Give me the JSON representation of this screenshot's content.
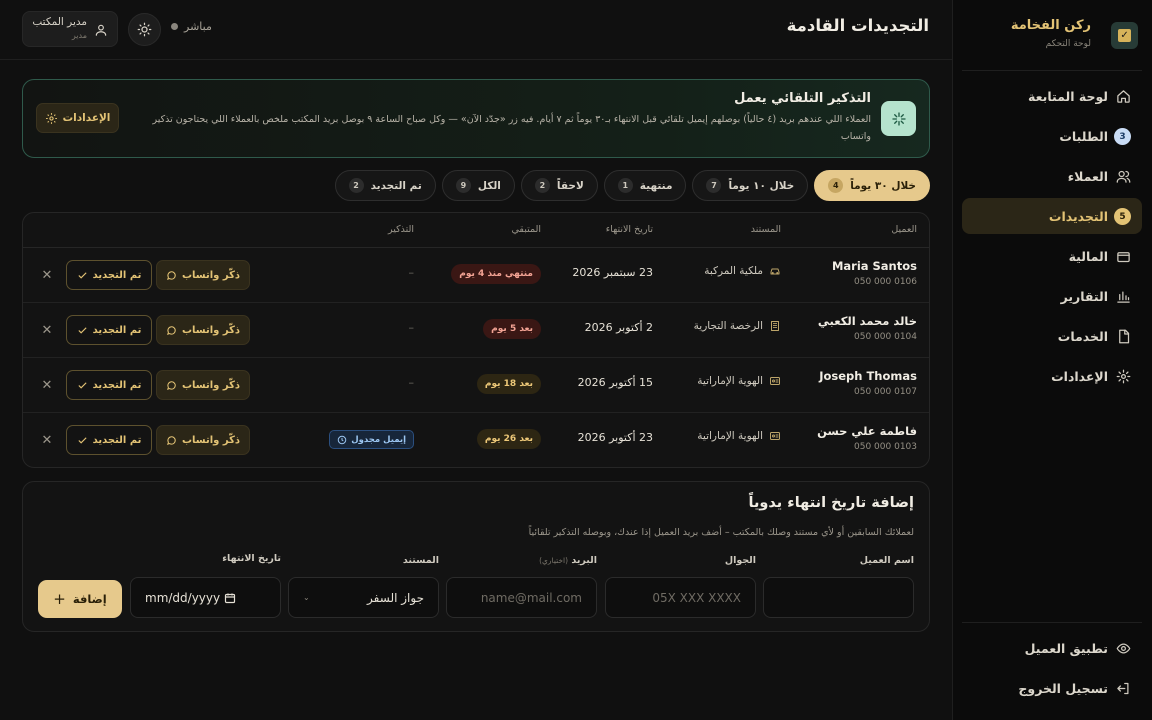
{
  "brand": {
    "title": "ركن الفخامة",
    "subtitle": "لوحة التحكم"
  },
  "nav": [
    {
      "label": "لوحة المتابعة",
      "icon": "home-icon",
      "badge": null,
      "active": false
    },
    {
      "label": "الطلبات",
      "icon": "list-icon",
      "badge": "3",
      "badge_color": "blue",
      "active": false
    },
    {
      "label": "العملاء",
      "icon": "users-icon",
      "badge": null,
      "active": false
    },
    {
      "label": "التجديدات",
      "icon": "bell-icon",
      "badge": "5",
      "badge_color": "gold",
      "active": true
    },
    {
      "label": "المالية",
      "icon": "wallet-icon",
      "badge": null,
      "active": false
    },
    {
      "label": "التقارير",
      "icon": "bar-chart-icon",
      "badge": null,
      "active": false
    },
    {
      "label": "الخدمات",
      "icon": "document-icon",
      "badge": null,
      "active": false
    },
    {
      "label": "الإعدادات",
      "icon": "gear-icon",
      "badge": null,
      "active": false
    }
  ],
  "bottom_nav": [
    {
      "label": "تطبيق العميل",
      "icon": "eye-icon"
    },
    {
      "label": "تسجيل الخروج",
      "icon": "logout-icon"
    }
  ],
  "header": {
    "title": "التجديدات القادمة",
    "user_name": "مدير المكتب",
    "user_role": "مدير",
    "live_label": "مباشر"
  },
  "banner": {
    "title": "التذكير التلقائي يعمل",
    "text": "العملاء اللي عندهم بريد (٤ حالياً) بوصلهم إيميل تلقائي قبل الانتهاء بـ٣٠ يوماً ثم ٧ أيام. فيه زر «جدّد الآن» — وكل صباح الساعة ٩ بوصل بريد المكتب ملخص بالعملاء اللي يحتاجون تذكير واتساب",
    "button": "الإعدادات"
  },
  "filters": [
    {
      "label": "خلال ٣٠ يوماً",
      "count": "4",
      "active": true
    },
    {
      "label": "خلال ١٠ يوماً",
      "count": "7",
      "active": false
    },
    {
      "label": "منتهية",
      "count": "1",
      "active": false
    },
    {
      "label": "لاحقاً",
      "count": "2",
      "active": false
    },
    {
      "label": "الكل",
      "count": "9",
      "active": false
    },
    {
      "label": "تم التجديد",
      "count": "2",
      "active": false
    }
  ],
  "table": {
    "headers": {
      "client": "العميل",
      "document": "المستند",
      "expiry": "تاريخ الانتهاء",
      "remaining": "المتبقي",
      "reminder": "التذكير"
    },
    "actions": {
      "whatsapp": "ذكّر واتساب",
      "done": "تم التجديد"
    },
    "rows": [
      {
        "name": "Maria Santos",
        "phone": "050 000 0106",
        "document": "ملكية المركبة",
        "doc_icon": "car-icon",
        "expiry": "23 سبتمبر 2026",
        "remaining": "منتهي منذ 4 يوم",
        "remaining_style": "red",
        "reminder": "–",
        "reminder_badge": null
      },
      {
        "name": "خالد محمد الكعبي",
        "phone": "050 000 0104",
        "document": "الرخصة التجارية",
        "doc_icon": "building-icon",
        "expiry": "2 أكتوبر 2026",
        "remaining": "بعد 5 يوم",
        "remaining_style": "red",
        "reminder": "–",
        "reminder_badge": null
      },
      {
        "name": "Joseph Thomas",
        "phone": "050 000 0107",
        "document": "الهوية الإماراتية",
        "doc_icon": "id-card-icon",
        "expiry": "15 أكتوبر 2026",
        "remaining": "بعد 18 يوم",
        "remaining_style": "amber",
        "reminder": "–",
        "reminder_badge": null
      },
      {
        "name": "فاطمة علي حسن",
        "phone": "050 000 0103",
        "document": "الهوية الإماراتية",
        "doc_icon": "id-card-icon",
        "expiry": "23 أكتوبر 2026",
        "remaining": "بعد 26 يوم",
        "remaining_style": "amber",
        "reminder": "",
        "reminder_badge": "إيميل مجدول"
      }
    ]
  },
  "form": {
    "title": "إضافة تاريخ انتهاء يدوياً",
    "description": "لعملائك السابقين أو لأي مستند وصلك بالمكتب – أضف بريد العميل إذا عندك، وبوصله التذكير تلقائياً",
    "labels": {
      "name": "اسم العميل",
      "phone": "الجوال",
      "email": "البريد",
      "email_hint": "(اختياري)",
      "document": "المستند",
      "expiry": "تاريخ الانتهاء"
    },
    "placeholders": {
      "phone": "05X XXX XXXX",
      "email": "name@mail.com"
    },
    "document_value": "جواز السفر",
    "date_value": "mm/dd/yyyy",
    "add_button": "إضافة"
  }
}
